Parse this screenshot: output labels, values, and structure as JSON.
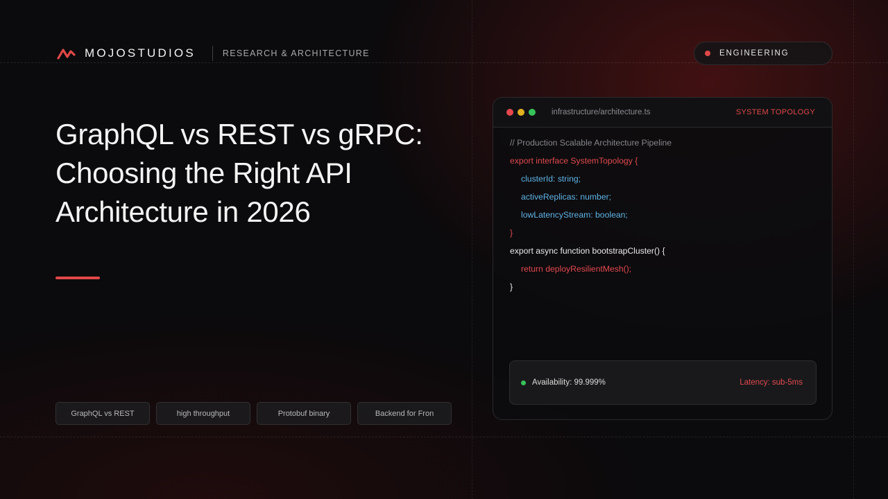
{
  "brand": {
    "name": "MOJOSTUDIOS",
    "subtitle": "RESEARCH & ARCHITECTURE",
    "accent_color": "#e04848",
    "logo_icon": "zigzag-logo-icon"
  },
  "category_pill": {
    "label": "ENGINEERING",
    "dot_color": "#e04848"
  },
  "hero": {
    "title_lines": [
      "GraphQL vs REST vs gRPC:",
      "Choosing the Right API",
      "Architecture in 2026"
    ]
  },
  "tags": [
    "GraphQL vs REST",
    "high throughput",
    "Protobuf binary",
    "Backend for Fron"
  ],
  "editor": {
    "file_path": "infrastructure/architecture.ts",
    "label": "SYSTEM TOPOLOGY",
    "code_lines": [
      "// Production Scalable Architecture Pipeline",
      "export interface SystemTopology {",
      "clusterId: string;",
      "activeReplicas: number;",
      "lowLatencyStream: boolean;",
      "}",
      "export async function bootstrapCluster() {",
      "return deployResilientMesh();",
      "}"
    ],
    "status": {
      "availability": "Availability: 99.999%",
      "latency": "Latency: sub-5ms",
      "ok_color": "#37c25b"
    }
  }
}
